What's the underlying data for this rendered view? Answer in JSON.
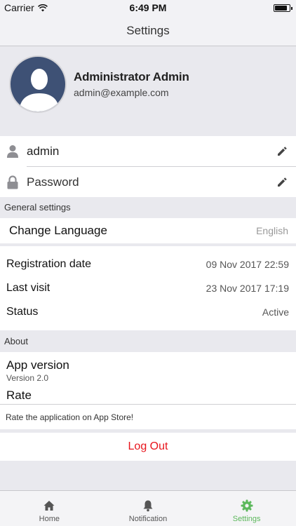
{
  "status_bar": {
    "carrier": "Carrier",
    "time": "6:49 PM",
    "battery_level": 0.85
  },
  "nav": {
    "title": "Settings"
  },
  "profile": {
    "name": "Administrator Admin",
    "email": "admin@example.com"
  },
  "credentials": {
    "username": "admin",
    "password_placeholder": "Password"
  },
  "general": {
    "header": "General settings",
    "language_label": "Change Language",
    "language_value": "English"
  },
  "account": {
    "registration_label": "Registration date",
    "registration_value": "09 Nov 2017 22:59",
    "last_visit_label": "Last visit",
    "last_visit_value": "23 Nov 2017 17:19",
    "status_label": "Status",
    "status_value": "Active"
  },
  "about": {
    "header": "About",
    "app_version_label": "App version",
    "app_version_value": "Version 2.0",
    "rate_label": "Rate",
    "rate_description": "Rate the application on App Store!"
  },
  "logout_label": "Log Out",
  "tabs": [
    {
      "label": "Home",
      "icon": "home-icon"
    },
    {
      "label": "Notification",
      "icon": "bell-icon"
    },
    {
      "label": "Settings",
      "icon": "gear-icon"
    }
  ],
  "colors": {
    "accent": "#5cb85c",
    "danger": "#e8141c",
    "avatar_bg": "#3e5175"
  }
}
